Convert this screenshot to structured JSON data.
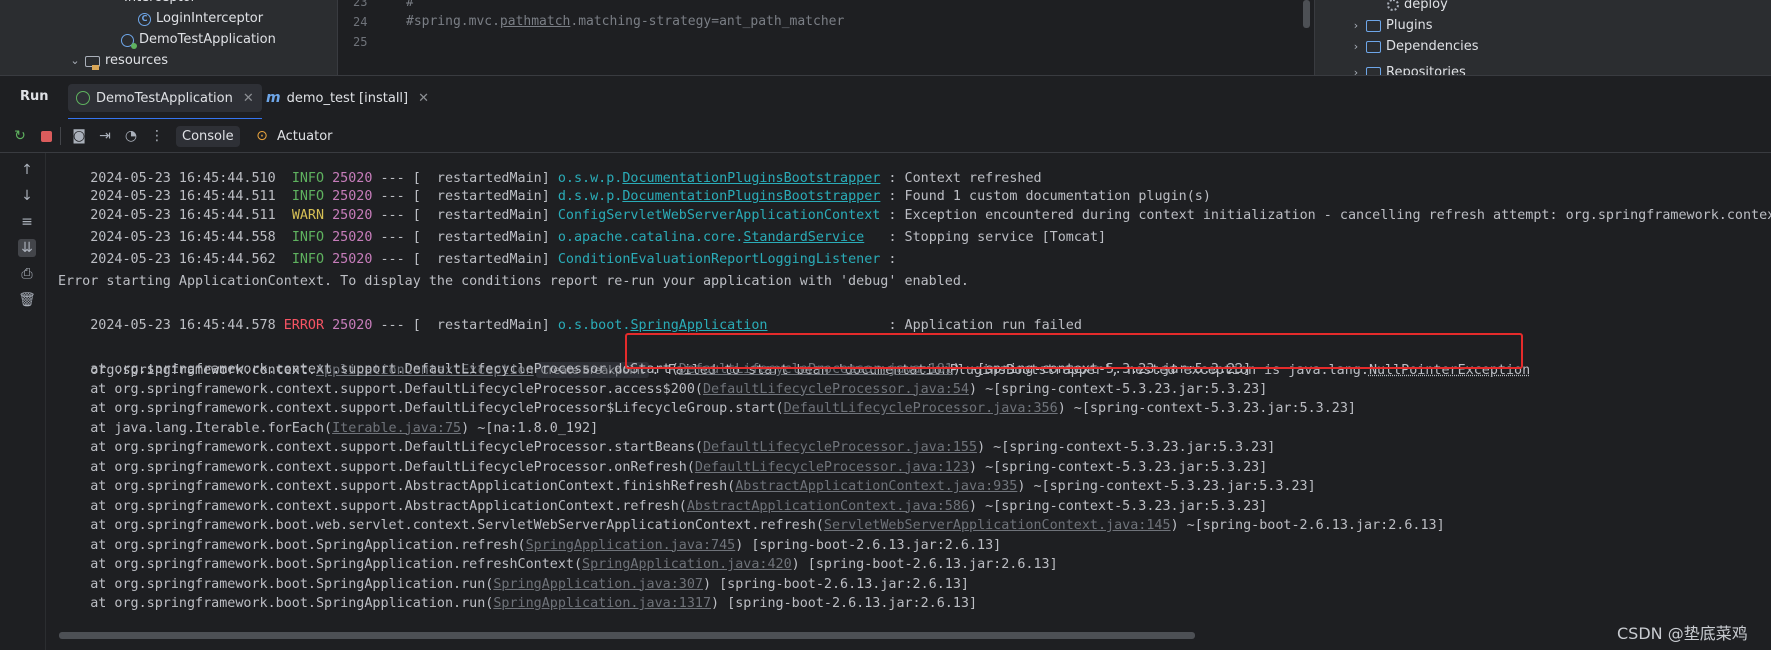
{
  "project_tree": {
    "items": [
      {
        "label": "Interceptor",
        "kind": "folder"
      },
      {
        "label": "LoginInterceptor",
        "kind": "class"
      },
      {
        "label": "DemoTestApplication",
        "kind": "spring-class"
      },
      {
        "label": "resources",
        "kind": "folder"
      }
    ]
  },
  "editor": {
    "lines": [
      {
        "num": "23",
        "text": "#"
      },
      {
        "num": "24",
        "text_before": "#spring.mvc.",
        "text_under": "pathmatch",
        "text_after": ".matching-strategy=ant_path_matcher"
      },
      {
        "num": "25",
        "text": ""
      }
    ]
  },
  "maven": {
    "items": [
      {
        "label": "deploy",
        "icon": "gear-icon"
      },
      {
        "label": "Plugins",
        "icon": "folder-icon"
      },
      {
        "label": "Dependencies",
        "icon": "folder-icon"
      },
      {
        "label": "Repositories",
        "icon": "folder-icon"
      }
    ]
  },
  "run": {
    "title": "Run",
    "tabs": [
      {
        "label": "DemoTestApplication",
        "active": true
      },
      {
        "label": "demo_test [install]",
        "active": false
      }
    ],
    "toolbar": {
      "console_label": "Console",
      "actuator_label": "Actuator"
    }
  },
  "console": {
    "log_lines": [
      {
        "ts": "2024-05-23 16:45:44.510",
        "level": "INFO",
        "pid": "25020",
        "thread": "  restartedMain",
        "logger_pre": "o.s.w.p.",
        "logger_u": "DocumentationPluginsBootstrapper",
        "logger_post": "",
        "msg": ": Context refreshed"
      },
      {
        "ts": "2024-05-23 16:45:44.511",
        "level": "INFO",
        "pid": "25020",
        "thread": "  restartedMain",
        "logger_pre": "d.s.w.p.",
        "logger_u": "DocumentationPluginsBootstrapper",
        "logger_post": "",
        "msg": ": Found 1 custom documentation plugin(s)"
      },
      {
        "ts": "2024-05-23 16:45:44.511",
        "level": "WARN",
        "pid": "25020",
        "thread": "  restartedMain",
        "logger_pre": "ConfigServletWebServerApplicationContext",
        "logger_u": "",
        "logger_post": "",
        "msg": ": Exception encountered during context initialization - cancelling refresh attempt: org.springframework.context.App"
      },
      {
        "ts": "2024-05-23 16:45:44.558",
        "level": "INFO",
        "pid": "25020",
        "thread": "  restartedMain",
        "logger_pre": "o.apache.catalina.core.",
        "logger_u": "StandardService",
        "logger_post": "  ",
        "msg": ": Stopping service [Tomcat]"
      },
      {
        "ts": "2024-05-23 16:45:44.562",
        "level": "INFO",
        "pid": "25020",
        "thread": "  restartedMain",
        "logger_pre": "ConditionEvaluationReportLoggingListener",
        "logger_u": "",
        "logger_post": "",
        "msg": ":"
      }
    ],
    "error_starting": "Error starting ApplicationContext. To display the conditions report re-run your application with 'debug' enabled.",
    "error_line": {
      "ts": "2024-05-23 16:45:44.578",
      "level": "ERROR",
      "pid": "25020",
      "thread": "  restartedMain",
      "logger_pre": "o.s.boot.",
      "logger_u": "SpringApplication",
      "logger_post": "              ",
      "msg": ": Application run failed"
    },
    "exception": {
      "prefix": "org.springframework.context.",
      "class_link": "ApplicationContextException",
      "breakpoint_hint": "Create breakpoint",
      "message_pre": ": Failed to start bean 'documentationPluginsBootstrapper'; nested exception is java.lang.",
      "npe": "NullPointerException"
    },
    "stack": [
      {
        "pre": "    at org.springframework.context.support.DefaultLifecycleProcessor.doStart(",
        "link": "DefaultLifecycleProcessor.java:181",
        "post": ") ~[spring-context-5.3.23.jar:5.3.23]"
      },
      {
        "pre": "    at org.springframework.context.support.DefaultLifecycleProcessor.access$200(",
        "link": "DefaultLifecycleProcessor.java:54",
        "post": ") ~[spring-context-5.3.23.jar:5.3.23]"
      },
      {
        "pre": "    at org.springframework.context.support.DefaultLifecycleProcessor$LifecycleGroup.start(",
        "link": "DefaultLifecycleProcessor.java:356",
        "post": ") ~[spring-context-5.3.23.jar:5.3.23]"
      },
      {
        "pre": "    at java.lang.Iterable.forEach(",
        "link": "Iterable.java:75",
        "post": ") ~[na:1.8.0_192]"
      },
      {
        "pre": "    at org.springframework.context.support.DefaultLifecycleProcessor.startBeans(",
        "link": "DefaultLifecycleProcessor.java:155",
        "post": ") ~[spring-context-5.3.23.jar:5.3.23]"
      },
      {
        "pre": "    at org.springframework.context.support.DefaultLifecycleProcessor.onRefresh(",
        "link": "DefaultLifecycleProcessor.java:123",
        "post": ") ~[spring-context-5.3.23.jar:5.3.23]"
      },
      {
        "pre": "    at org.springframework.context.support.AbstractApplicationContext.finishRefresh(",
        "link": "AbstractApplicationContext.java:935",
        "post": ") ~[spring-context-5.3.23.jar:5.3.23]"
      },
      {
        "pre": "    at org.springframework.context.support.AbstractApplicationContext.refresh(",
        "link": "AbstractApplicationContext.java:586",
        "post": ") ~[spring-context-5.3.23.jar:5.3.23]"
      },
      {
        "pre": "    at org.springframework.boot.web.servlet.context.ServletWebServerApplicationContext.refresh(",
        "link": "ServletWebServerApplicationContext.java:145",
        "post": ") ~[spring-boot-2.6.13.jar:2.6.13]"
      },
      {
        "pre": "    at org.springframework.boot.SpringApplication.refresh(",
        "link": "SpringApplication.java:745",
        "post": ") [spring-boot-2.6.13.jar:2.6.13]"
      },
      {
        "pre": "    at org.springframework.boot.SpringApplication.refreshContext(",
        "link": "SpringApplication.java:420",
        "post": ") [spring-boot-2.6.13.jar:2.6.13]"
      },
      {
        "pre": "    at org.springframework.boot.SpringApplication.run(",
        "link": "SpringApplication.java:307",
        "post": ") [spring-boot-2.6.13.jar:2.6.13]"
      },
      {
        "pre": "    at org.springframework.boot.SpringApplication.run(",
        "link": "SpringApplication.java:1317",
        "post": ") [spring-boot-2.6.13.jar:2.6.13]"
      }
    ]
  },
  "watermark": "CSDN @垫底菜鸡",
  "colors": {
    "accent": "#3574f0",
    "highlight_box": "#e52b2b",
    "info": "#5fb25f",
    "warn": "#d6bf55",
    "error": "#f75464"
  }
}
